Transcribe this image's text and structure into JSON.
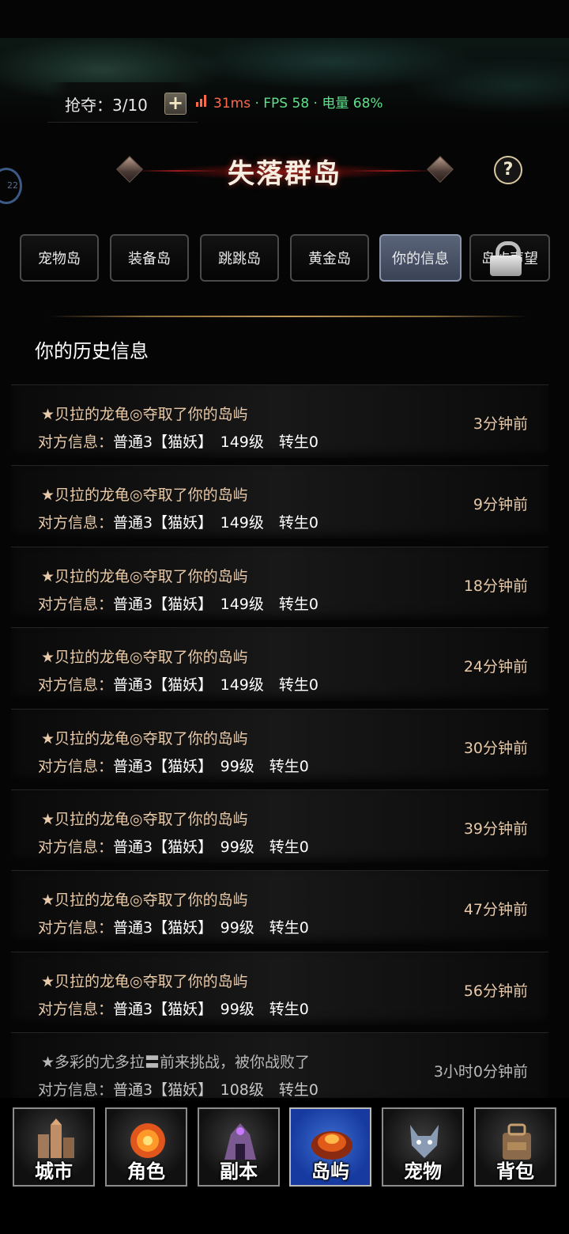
{
  "status": {
    "rob_label": "抢夺：3/10",
    "plus_label": "+",
    "ping": "31ms",
    "rest": "· FPS 58 · 电量 68%"
  },
  "side_badge": "22",
  "header": {
    "title": "失落群岛",
    "help": "?"
  },
  "tabs": [
    {
      "label": "宠物岛"
    },
    {
      "label": "装备岛"
    },
    {
      "label": "跳跳岛"
    },
    {
      "label": "黄金岛"
    },
    {
      "label": "你的信息"
    },
    {
      "label": "岛屿声望"
    }
  ],
  "section_title": "你的历史信息",
  "info_prefix": "对方信息：",
  "records": [
    {
      "event": "★贝拉的龙龟◎夺取了你的岛屿",
      "info": "普通3【猫妖】　149级　转生0",
      "time": "3分钟前"
    },
    {
      "event": "★贝拉的龙龟◎夺取了你的岛屿",
      "info": "普通3【猫妖】　149级　转生0",
      "time": "9分钟前"
    },
    {
      "event": "★贝拉的龙龟◎夺取了你的岛屿",
      "info": "普通3【猫妖】　149级　转生0",
      "time": "18分钟前"
    },
    {
      "event": "★贝拉的龙龟◎夺取了你的岛屿",
      "info": "普通3【猫妖】　149级　转生0",
      "time": "24分钟前"
    },
    {
      "event": "★贝拉的龙龟◎夺取了你的岛屿",
      "info": "普通3【猫妖】　99级　转生0",
      "time": "30分钟前"
    },
    {
      "event": "★贝拉的龙龟◎夺取了你的岛屿",
      "info": "普通3【猫妖】　99级　转生0",
      "time": "39分钟前"
    },
    {
      "event": "★贝拉的龙龟◎夺取了你的岛屿",
      "info": "普通3【猫妖】　99级　转生0",
      "time": "47分钟前"
    },
    {
      "event": "★贝拉的龙龟◎夺取了你的岛屿",
      "info": "普通3【猫妖】　99级　转生0",
      "time": "56分钟前"
    },
    {
      "event": "★多彩的尤多拉〓前来挑战，被你战败了",
      "info": "普通3【猫妖】　108级　转生0",
      "time": "3小时0分钟前"
    }
  ],
  "nav": [
    {
      "label": "城市",
      "icon": "city-icon"
    },
    {
      "label": "角色",
      "icon": "character-icon"
    },
    {
      "label": "副本",
      "icon": "dungeon-icon"
    },
    {
      "label": "岛屿",
      "icon": "island-icon"
    },
    {
      "label": "宠物",
      "icon": "pet-icon"
    },
    {
      "label": "背包",
      "icon": "backpack-icon"
    }
  ],
  "colors": {
    "gold_text": "#e8c9a8",
    "active_tab": "#5a6478",
    "active_nav": "#1f4bbf",
    "ping_red": "#ff6a4a",
    "fps_green": "#5ee08a"
  }
}
